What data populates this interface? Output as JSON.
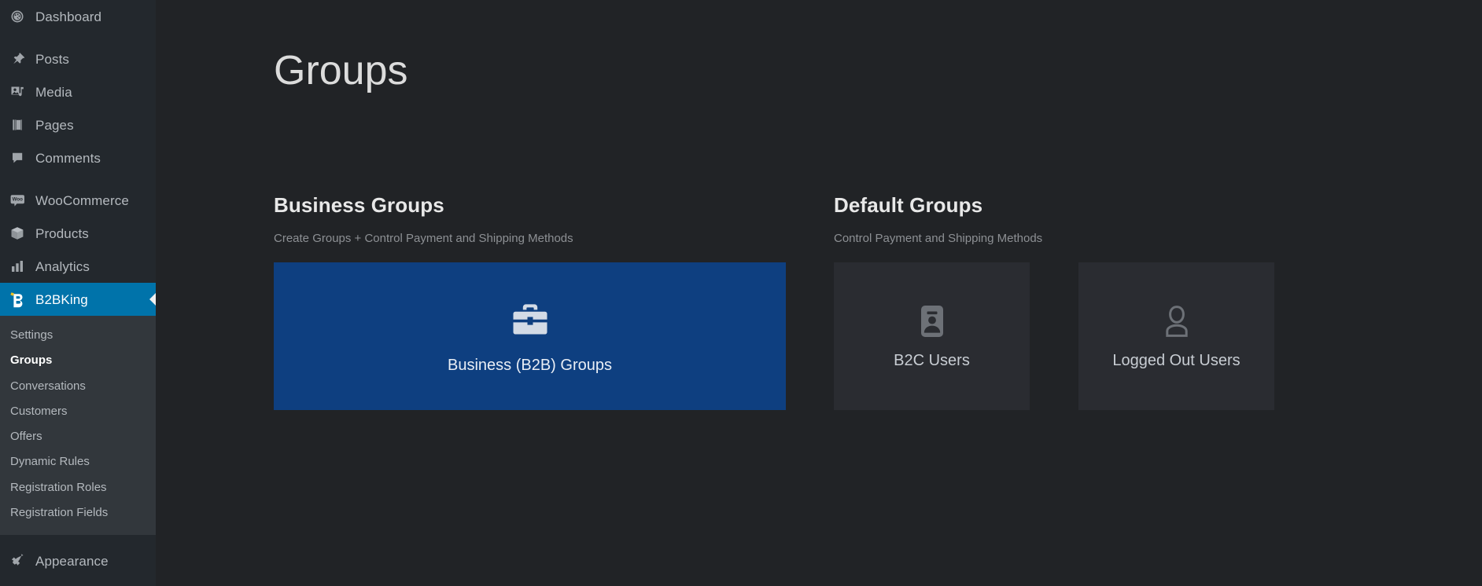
{
  "sidebar": {
    "items": [
      {
        "label": "Dashboard",
        "icon": "dashboard-icon",
        "current": false,
        "sep_after": true
      },
      {
        "label": "Posts",
        "icon": "pin-icon",
        "current": false,
        "sep_after": false
      },
      {
        "label": "Media",
        "icon": "media-icon",
        "current": false,
        "sep_after": false
      },
      {
        "label": "Pages",
        "icon": "pages-icon",
        "current": false,
        "sep_after": false
      },
      {
        "label": "Comments",
        "icon": "comments-icon",
        "current": false,
        "sep_after": true
      },
      {
        "label": "WooCommerce",
        "icon": "woocommerce-icon",
        "current": false,
        "sep_after": false
      },
      {
        "label": "Products",
        "icon": "products-icon",
        "current": false,
        "sep_after": false
      },
      {
        "label": "Analytics",
        "icon": "analytics-icon",
        "current": false,
        "sep_after": false
      },
      {
        "label": "B2BKing",
        "icon": "b2bking-icon",
        "current": true,
        "sep_after": false
      }
    ],
    "submenu": [
      {
        "label": "Settings",
        "current": false
      },
      {
        "label": "Groups",
        "current": true
      },
      {
        "label": "Conversations",
        "current": false
      },
      {
        "label": "Customers",
        "current": false
      },
      {
        "label": "Offers",
        "current": false
      },
      {
        "label": "Dynamic Rules",
        "current": false
      },
      {
        "label": "Registration Roles",
        "current": false
      },
      {
        "label": "Registration Fields",
        "current": false
      }
    ],
    "after_submenu": [
      {
        "label": "Appearance",
        "icon": "appearance-icon",
        "current": false
      }
    ],
    "colors": {
      "background": "#23282d",
      "submenu_background": "#32373c",
      "active": "#0073aa",
      "text": "#b4b9be",
      "text_active": "#ffffff"
    }
  },
  "page": {
    "title": "Groups"
  },
  "business_section": {
    "title": "Business Groups",
    "subtitle": "Create Groups + Control Payment and Shipping Methods",
    "cards": [
      {
        "label": "Business (B2B) Groups",
        "icon": "briefcase-icon",
        "color": "#0e3f80",
        "style": "wide"
      }
    ]
  },
  "default_section": {
    "title": "Default Groups",
    "subtitle": "Control Payment and Shipping Methods",
    "cards": [
      {
        "label": "B2C Users",
        "icon": "id-badge-icon",
        "color": "#2a2c31",
        "style": "small"
      },
      {
        "label": "Logged Out Users",
        "icon": "user-outline-icon",
        "color": "#2a2c31",
        "style": "small"
      }
    ]
  },
  "theme": {
    "content_background": "#212326",
    "accent": "#0073aa",
    "card_blue": "#0e3f80",
    "card_gray": "#2a2c31",
    "heading_text": "#e8e8e8",
    "muted_text": "#8d9094"
  }
}
